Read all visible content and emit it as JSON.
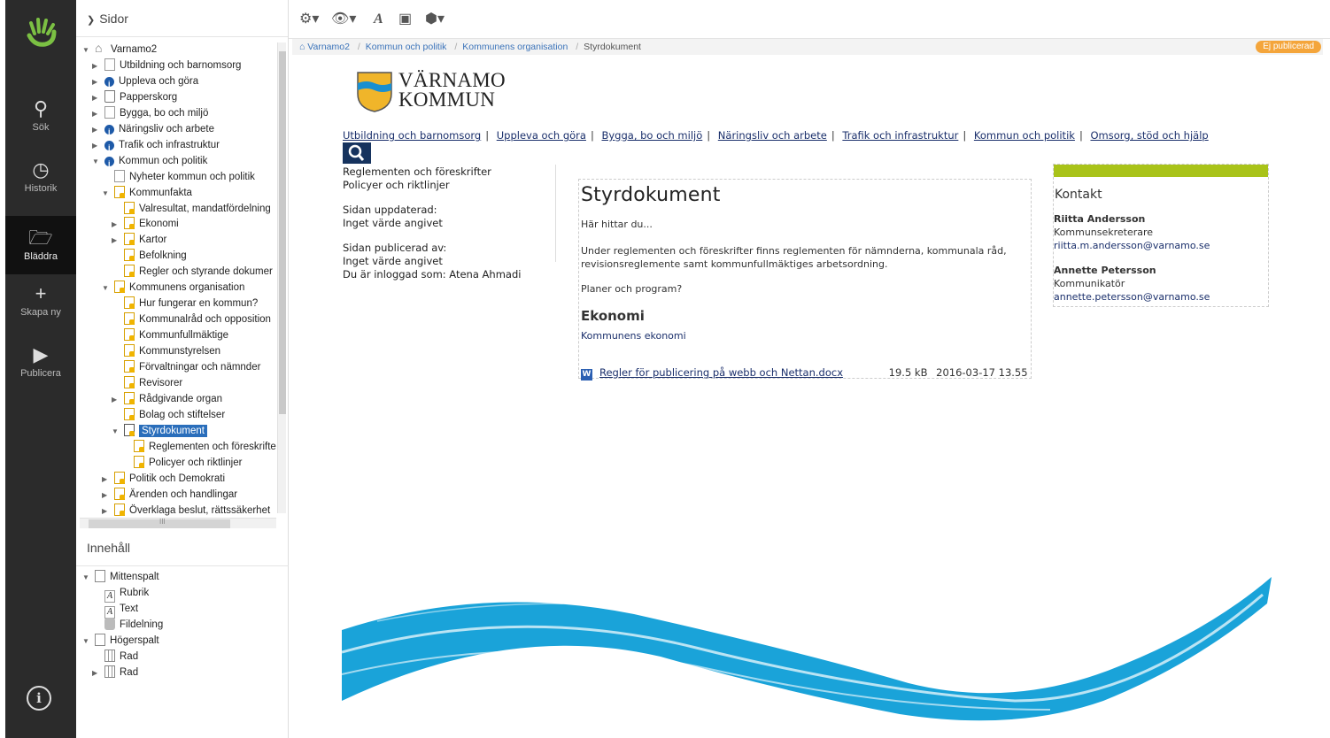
{
  "rail": {
    "items": [
      {
        "label": "Sök",
        "icon": "search-icon"
      },
      {
        "label": "Historik",
        "icon": "history-icon"
      },
      {
        "label": "Bläddra",
        "icon": "folder-icon"
      },
      {
        "label": "Skapa ny",
        "icon": "plus-icon"
      },
      {
        "label": "Publicera",
        "icon": "play-icon"
      }
    ],
    "info": "i"
  },
  "tree": {
    "header": "Sidor",
    "nodes": [
      {
        "label": "Varnamo2"
      },
      {
        "label": "Utbildning och barnomsorg"
      },
      {
        "label": "Uppleva och göra"
      },
      {
        "label": "Papperskorg"
      },
      {
        "label": "Bygga, bo och miljö"
      },
      {
        "label": "Näringsliv och arbete"
      },
      {
        "label": "Trafik och infrastruktur"
      },
      {
        "label": "Kommun och politik"
      },
      {
        "label": "Nyheter kommun och politik"
      },
      {
        "label": "Kommunfakta"
      },
      {
        "label": "Valresultat, mandatfördelning"
      },
      {
        "label": "Ekonomi"
      },
      {
        "label": "Kartor"
      },
      {
        "label": "Befolkning"
      },
      {
        "label": "Regler och styrande dokumer"
      },
      {
        "label": "Kommunens organisation"
      },
      {
        "label": "Hur fungerar en kommun?"
      },
      {
        "label": "Kommunalråd och opposition"
      },
      {
        "label": "Kommunfullmäktige"
      },
      {
        "label": "Kommunstyrelsen"
      },
      {
        "label": "Förvaltningar och nämnder"
      },
      {
        "label": "Revisorer"
      },
      {
        "label": "Rådgivande organ"
      },
      {
        "label": "Bolag och stiftelser"
      },
      {
        "label": "Styrdokument"
      },
      {
        "label": "Reglementen och föreskrifte"
      },
      {
        "label": "Policyer och riktlinjer"
      },
      {
        "label": "Politik och Demokrati"
      },
      {
        "label": "Ärenden och handlingar"
      },
      {
        "label": "Överklaga beslut, rättssäkerhet"
      }
    ],
    "scroll_grip": "III"
  },
  "content_panel": {
    "header": "Innehåll",
    "nodes": [
      {
        "label": "Mittenspalt"
      },
      {
        "label": "Rubrik"
      },
      {
        "label": "Text"
      },
      {
        "label": "Fildelning"
      },
      {
        "label": "Högerspalt"
      },
      {
        "label": "Rad"
      },
      {
        "label": "Rad"
      }
    ]
  },
  "breadcrumb": [
    "Varnamo2",
    "Kommun och politik",
    "Kommunens organisation",
    "Styrdokument"
  ],
  "status_badge": "Ej publicerad",
  "site": {
    "name_line1": "VÄRNAMO",
    "name_line2": "KOMMUN",
    "nav": [
      "Utbildning och barnomsorg",
      "Uppleva och göra",
      "Bygga, bo och miljö",
      "Näringsliv och arbete",
      "Trafik och infrastruktur",
      "Kommun och politik",
      "Omsorg, stöd och hjälp"
    ],
    "left": {
      "links": [
        "Reglementen och föreskrifter",
        "Policyer och riktlinjer"
      ],
      "updated_label": "Sidan uppdaterad:",
      "updated_value": "Inget värde angivet",
      "published_label": "Sidan publicerad av:",
      "published_value": "Inget värde angivet",
      "logged_in": "Du är inloggad som: Atena Ahmadi"
    },
    "main": {
      "title": "Styrdokument",
      "intro": "Här hittar du...",
      "body": "Under reglementen och föreskrifter finns reglementen för nämnderna, kommunala råd, revisionsreglemente samt kommunfullmäktiges arbetsordning.",
      "plans": "Planer och program?",
      "h2": "Ekonomi",
      "link": "Kommunens ekonomi",
      "file": {
        "name": "Regler för publicering på webb och Nettan.docx",
        "size": "19.5 kB",
        "date": "2016-03-17 13.55"
      }
    },
    "contact": {
      "title": "Kontakt",
      "people": [
        {
          "name": "Riitta Andersson",
          "role": "Kommunsekreterare",
          "email": "riitta.m.andersson@varnamo.se"
        },
        {
          "name": "Annette Petersson",
          "role": "Kommunikatör",
          "email": "annette.petersson@varnamo.se"
        }
      ]
    }
  },
  "colors": {
    "accent": "#2a6ebb",
    "status": "#f4a53b",
    "green": "#a9c319",
    "wave": "#1aa3d9",
    "navy": "#16335e"
  }
}
